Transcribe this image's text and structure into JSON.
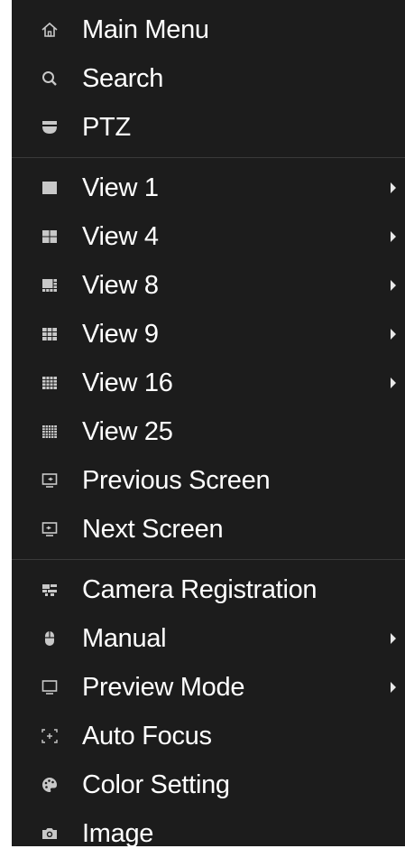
{
  "menu": {
    "groups": [
      [
        {
          "label": "Main Menu",
          "icon": "home-icon",
          "submenu": false
        },
        {
          "label": "Search",
          "icon": "search-icon",
          "submenu": false
        },
        {
          "label": "PTZ",
          "icon": "ptz-camera-icon",
          "submenu": false
        }
      ],
      [
        {
          "label": "View 1",
          "icon": "view-1-icon",
          "submenu": true
        },
        {
          "label": "View 4",
          "icon": "view-4-icon",
          "submenu": true
        },
        {
          "label": "View 8",
          "icon": "view-8-icon",
          "submenu": true
        },
        {
          "label": "View 9",
          "icon": "view-9-icon",
          "submenu": true
        },
        {
          "label": "View 16",
          "icon": "view-16-icon",
          "submenu": true
        },
        {
          "label": "View 25",
          "icon": "view-25-icon",
          "submenu": false
        },
        {
          "label": "Previous Screen",
          "icon": "previous-screen-icon",
          "submenu": false
        },
        {
          "label": "Next Screen",
          "icon": "next-screen-icon",
          "submenu": false
        }
      ],
      [
        {
          "label": "Camera Registration",
          "icon": "camera-registration-icon",
          "submenu": false
        },
        {
          "label": "Manual",
          "icon": "mouse-icon",
          "submenu": true
        },
        {
          "label": "Preview Mode",
          "icon": "monitor-icon",
          "submenu": true
        },
        {
          "label": "Auto Focus",
          "icon": "focus-icon",
          "submenu": false
        },
        {
          "label": "Color Setting",
          "icon": "palette-icon",
          "submenu": false
        },
        {
          "label": "Image",
          "icon": "camera-icon",
          "submenu": false
        }
      ]
    ],
    "colors": {
      "background": "#1c1c1c",
      "text": "#ffffff",
      "icon": "#c8c8c8",
      "separator": "#3a3a3a"
    }
  }
}
